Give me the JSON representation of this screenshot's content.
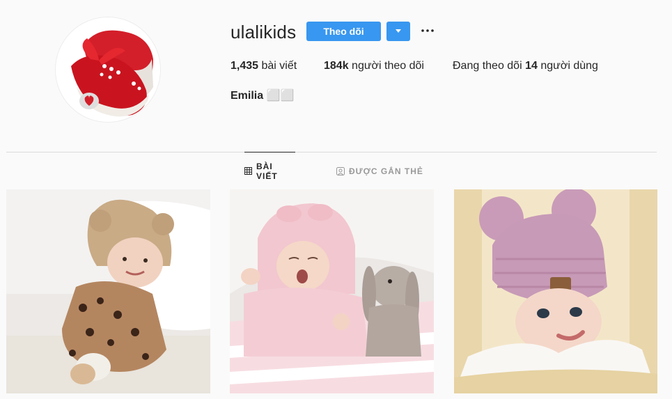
{
  "profile": {
    "username": "ulalikids",
    "follow_label": "Theo dõi",
    "more_label": "···",
    "fullname": "Emilia ⬜⬜",
    "stats": {
      "posts_count": "1,435",
      "posts_label": "bài viết",
      "followers_count": "184k",
      "followers_label": "người theo dõi",
      "following_prefix": "Đang theo dõi",
      "following_count": "14",
      "following_suffix": "người dùng"
    }
  },
  "tabs": [
    {
      "label": "BÀI VIẾT",
      "icon": "grid-icon",
      "active": true
    },
    {
      "label": "ĐƯỢC GẮN THẺ",
      "icon": "tag-icon",
      "active": false
    }
  ],
  "posts": [
    {
      "subject": "baby-knit-bear-hat",
      "icon": "photo"
    },
    {
      "subject": "baby-pink-hood-bunny",
      "icon": "photo"
    },
    {
      "subject": "baby-pink-pompom-beanie",
      "icon": "photo"
    }
  ],
  "colors": {
    "accent": "#3897f0",
    "background": "#fafafa",
    "text": "#262626",
    "muted": "#999999"
  }
}
